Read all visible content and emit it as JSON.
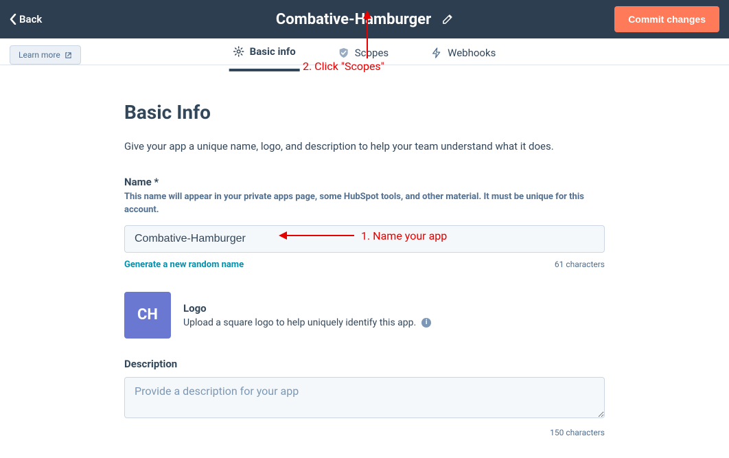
{
  "header": {
    "back_label": "Back",
    "title": "Combative-Hamburger",
    "commit_label": "Commit changes"
  },
  "subheader": {
    "learn_more_label": "Learn more"
  },
  "tabs": [
    {
      "label": "Basic info",
      "icon": "gear-icon",
      "active": true
    },
    {
      "label": "Scopes",
      "icon": "shield-check-icon",
      "active": false
    },
    {
      "label": "Webhooks",
      "icon": "lightning-icon",
      "active": false
    }
  ],
  "section": {
    "title": "Basic Info",
    "description": "Give your app a unique name, logo, and description to help your team understand what it does."
  },
  "name_field": {
    "label": "Name *",
    "help": "This name will appear in your private apps page, some HubSpot tools, and other material. It must be unique for this account.",
    "value": "Combative-Hamburger",
    "generate_link": "Generate a new random name",
    "char_count": "61 characters"
  },
  "logo_field": {
    "initials": "CH",
    "title": "Logo",
    "description": "Upload a square logo to help uniquely identify this app."
  },
  "description_field": {
    "label": "Description",
    "placeholder": "Provide a description for your app",
    "char_count": "150 characters"
  },
  "annotations": {
    "step1": "1. Name your app",
    "step2": "2. Click \"Scopes\""
  }
}
